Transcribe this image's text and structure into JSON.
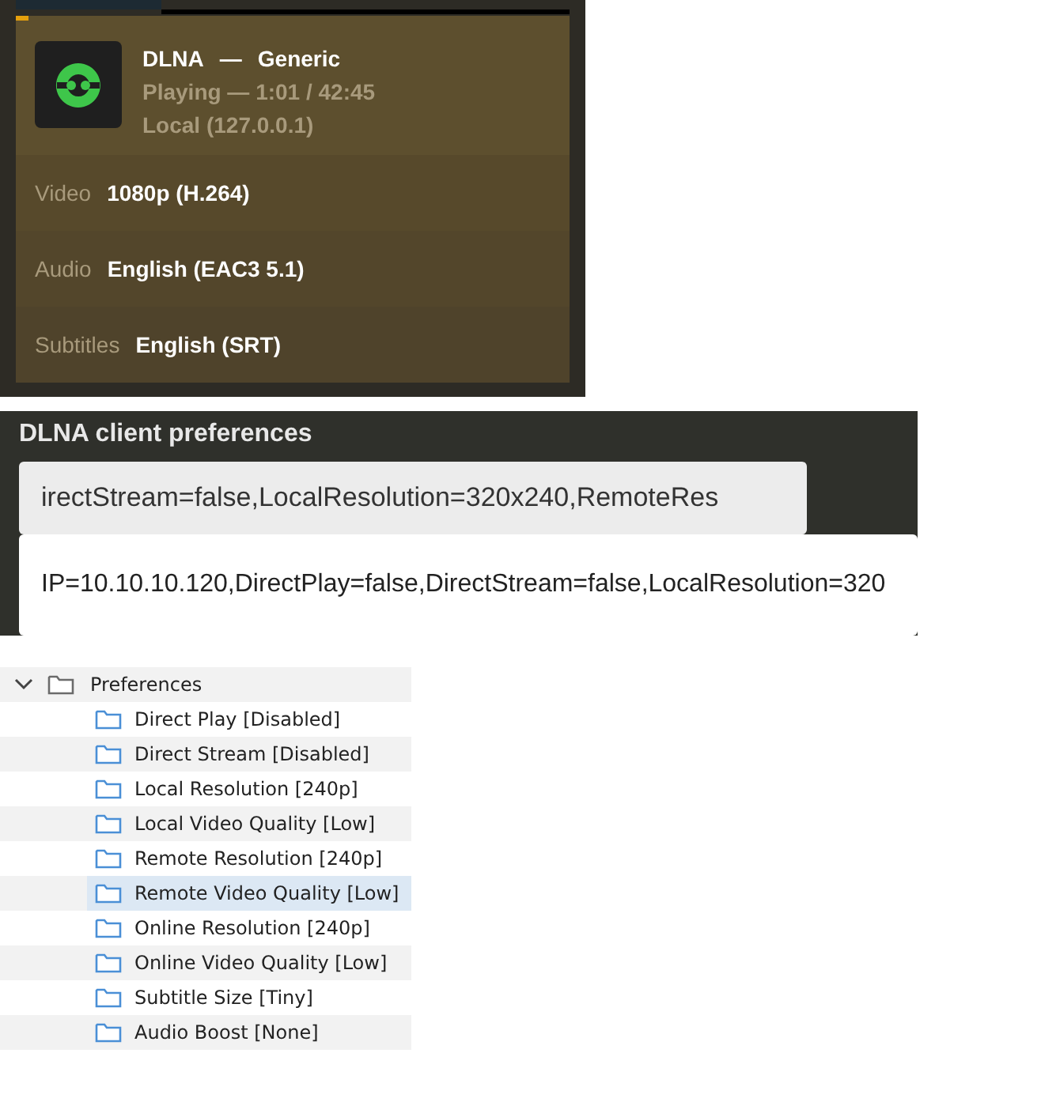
{
  "now_playing": {
    "title": "DLNA",
    "separator": "—",
    "subtitle": "Generic",
    "status": "Playing — 1:01 / 42:45",
    "address": "Local (127.0.0.1)",
    "streams": [
      {
        "label": "Video",
        "value": "1080p (H.264)"
      },
      {
        "label": "Audio",
        "value": "English (EAC3 5.1)"
      },
      {
        "label": "Subtitles",
        "value": "English (SRT)"
      }
    ]
  },
  "preferences_field": {
    "title": "DLNA client preferences",
    "value": "irectStream=false,LocalResolution=320x240,RemoteRes",
    "suggestion": "IP=10.10.10.120,DirectPlay=false,DirectStream=false,LocalResolution=320"
  },
  "tree": {
    "label": "Preferences",
    "expanded": true,
    "children": [
      {
        "label": "Direct Play [Disabled]",
        "selected": false
      },
      {
        "label": "Direct Stream [Disabled]",
        "selected": false
      },
      {
        "label": "Local Resolution [240p]",
        "selected": false
      },
      {
        "label": "Local Video Quality [Low]",
        "selected": false
      },
      {
        "label": "Remote Resolution [240p]",
        "selected": false
      },
      {
        "label": "Remote Video Quality [Low]",
        "selected": true
      },
      {
        "label": "Online Resolution [240p]",
        "selected": false
      },
      {
        "label": "Online Video Quality [Low]",
        "selected": false
      },
      {
        "label": "Subtitle Size [Tiny]",
        "selected": false
      },
      {
        "label": "Audio Boost [None]",
        "selected": false
      }
    ]
  }
}
